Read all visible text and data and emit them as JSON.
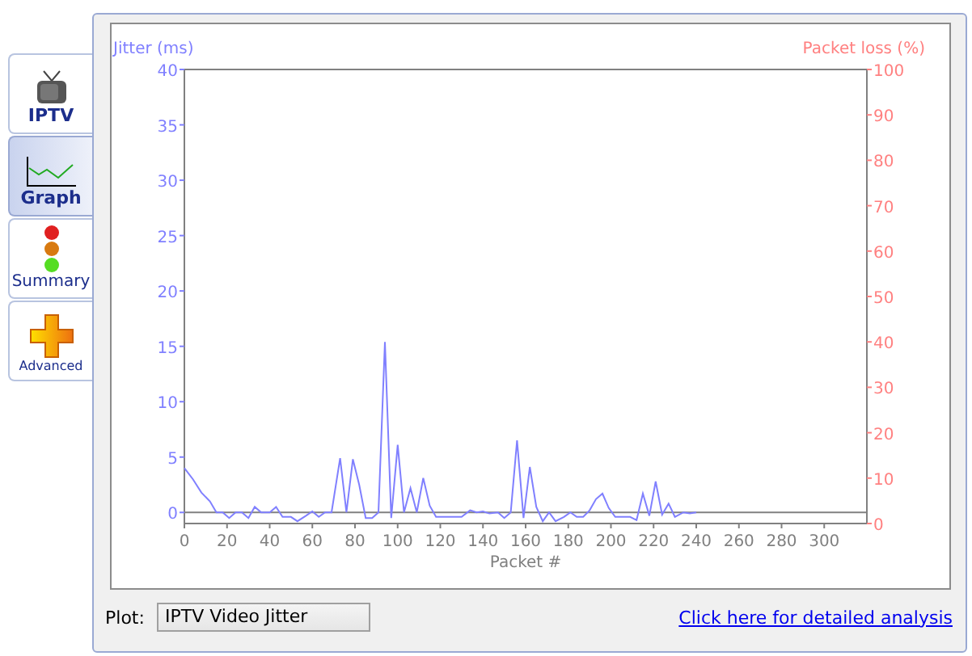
{
  "tabs": [
    {
      "label": "IPTV",
      "kind": "tv",
      "selected": false
    },
    {
      "label": "Graph",
      "kind": "graph",
      "selected": true
    },
    {
      "label": "Summary",
      "kind": "traffic",
      "selected": false
    },
    {
      "label": "Advanced",
      "kind": "plus",
      "selected": false
    }
  ],
  "chart": {
    "chart_data": {
      "type": "line",
      "xlabel": "Packet #",
      "ylabel": "Jitter (ms)",
      "xlim": [
        0,
        320
      ],
      "ylim": [
        -1,
        40
      ],
      "xticks": [
        0,
        20,
        40,
        60,
        80,
        100,
        120,
        140,
        160,
        180,
        200,
        220,
        240,
        260,
        280,
        300
      ],
      "yticks": [
        0,
        5,
        10,
        15,
        20,
        25,
        30,
        35,
        40
      ],
      "x": [
        0,
        4,
        8,
        12,
        15,
        18,
        21,
        24,
        27,
        30,
        33,
        36,
        40,
        43,
        46,
        50,
        53,
        57,
        60,
        63,
        66,
        69,
        73,
        76,
        79,
        82,
        85,
        88,
        91,
        94,
        97,
        100,
        103,
        106,
        109,
        112,
        115,
        118,
        122,
        126,
        130,
        134,
        137,
        140,
        143,
        147,
        150,
        153,
        156,
        159,
        162,
        165,
        168,
        171,
        174,
        178,
        181,
        184,
        187,
        190,
        193,
        196,
        199,
        202,
        206,
        209,
        212,
        215,
        218,
        221,
        224,
        227,
        230,
        234,
        237,
        240
      ],
      "series": [
        {
          "color": "#8080ff",
          "values": [
            4,
            3,
            1.8,
            1,
            0,
            0,
            -0.5,
            0,
            0,
            -0.5,
            0.5,
            0,
            0,
            0.5,
            -0.4,
            -0.4,
            -0.8,
            -0.3,
            0.1,
            -0.4,
            0,
            0,
            4.9,
            0,
            4.8,
            2.5,
            -0.5,
            -0.5,
            0,
            15.4,
            -0.5,
            6.1,
            0,
            2.2,
            0,
            3.1,
            0.6,
            -0.4,
            -0.4,
            -0.4,
            -0.4,
            0.2,
            0,
            0.1,
            -0.1,
            0,
            -0.5,
            0,
            6.5,
            -0.5,
            4.1,
            0.5,
            -0.8,
            0,
            -0.8,
            -0.4,
            0,
            -0.4,
            -0.4,
            0.2,
            1.2,
            1.7,
            0.4,
            -0.4,
            -0.4,
            -0.4,
            -0.7,
            1.7,
            -0.3,
            2.8,
            -0.2,
            0.8,
            -0.4,
            0,
            -0.1,
            0
          ]
        }
      ]
    },
    "right_axis": {
      "label": "Packet loss (%)",
      "ticks": [
        "100",
        "90",
        "80",
        "70",
        "60",
        "50",
        "40",
        "30",
        "20",
        "10",
        "0"
      ]
    }
  },
  "plot_label": "Plot:",
  "plot_value": "IPTV Video Jitter",
  "link": "Click here for detailed analysis"
}
